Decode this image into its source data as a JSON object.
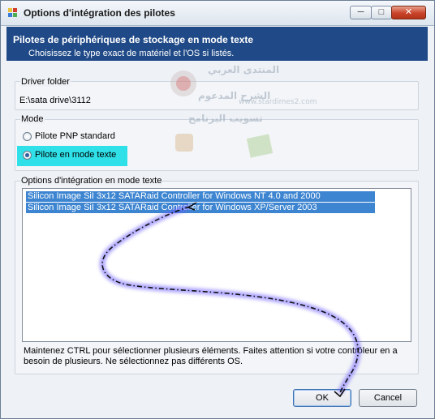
{
  "window": {
    "title": "Options d'intégration des pilotes",
    "minimize_glyph": "─",
    "maximize_glyph": "□",
    "close_glyph": "✕"
  },
  "header": {
    "title": "Pilotes de périphériques de stockage en mode texte",
    "subtitle": "Choisissez le type exact de matériel et l'OS si listés."
  },
  "driver_folder": {
    "label": "Driver folder",
    "path": "E:\\sata drive\\3112"
  },
  "mode": {
    "label": "Mode",
    "options": [
      {
        "label": "Pilote PNP standard",
        "checked": false
      },
      {
        "label": "Pilote en mode texte",
        "checked": true
      }
    ],
    "highlight_color": "#2fe0e8"
  },
  "text_mode_options": {
    "label": "Options d'intégration en mode texte",
    "items": [
      {
        "label": "Silicon Image SiI 3x12 SATARaid Controller for Windows NT 4.0 and 2000",
        "selected": true
      },
      {
        "label": "Silicon Image SiI 3x12 SATARaid Controller for Windows XP/Server 2003",
        "selected": true
      }
    ]
  },
  "help_text": "Maintenez CTRL pour sélectionner plusieurs éléments. Faites attention si votre contrôleur en a besoin de plusieurs. Ne sélectionnez pas différents OS.",
  "buttons": {
    "ok": "OK",
    "cancel": "Cancel"
  },
  "watermark": {
    "lines": [
      "المنتدى العربي",
      "الشرح المدعوم",
      "تسويب البرنامج",
      "www.stardimes2.com"
    ]
  },
  "colors": {
    "header_bg": "#204a87",
    "selection": "#3d85d1",
    "annotation_glow": "#6a5cff"
  }
}
